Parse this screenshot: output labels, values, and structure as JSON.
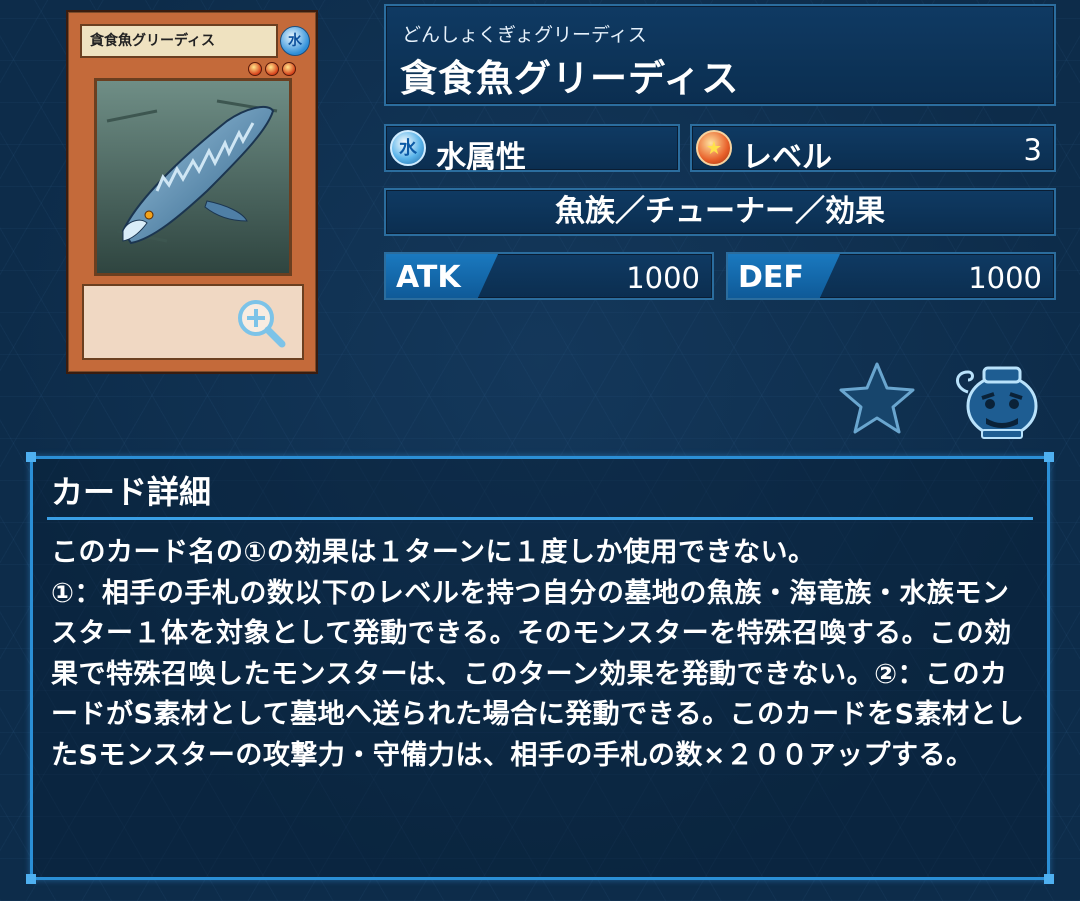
{
  "card_image": {
    "name_text": "貪食魚グリーディス",
    "attribute_glyph": "水",
    "stars": 3
  },
  "card": {
    "ruby": "どんしょくぎょグリーディス",
    "name": "貪食魚グリーディス",
    "attribute_label": "水属性",
    "attribute_icon": "water-attribute-icon",
    "level_label": "レベル",
    "level_value": "3",
    "type_line": "魚族／チューナー／効果",
    "atk_label": "ATK",
    "atk_value": "1000",
    "def_label": "DEF",
    "def_value": "1000"
  },
  "icons": {
    "favorite": "star-icon",
    "deck_pot": "pot-of-greed-icon",
    "zoom": "zoom-in-icon"
  },
  "detail": {
    "title": "カード詳細",
    "text": "このカード名の①の効果は１ターンに１度しか使用できない。\n①：相手の手札の数以下のレベルを持つ自分の墓地の魚族・海竜族・水族モンスター１体を対象として発動できる。そのモンスターを特殊召喚する。この効果で特殊召喚したモンスターは、このターン効果を発動できない。②：このカードがS素材として墓地へ送られた場合に発動できる。このカードをS素材としたSモンスターの攻撃力・守備力は、相手の手札の数×２００アップする。"
  },
  "colors": {
    "background": "#0d2c4a",
    "panel": "#0f3a63",
    "accent": "#2b8fd6",
    "card_frame": "#c46a3a"
  }
}
